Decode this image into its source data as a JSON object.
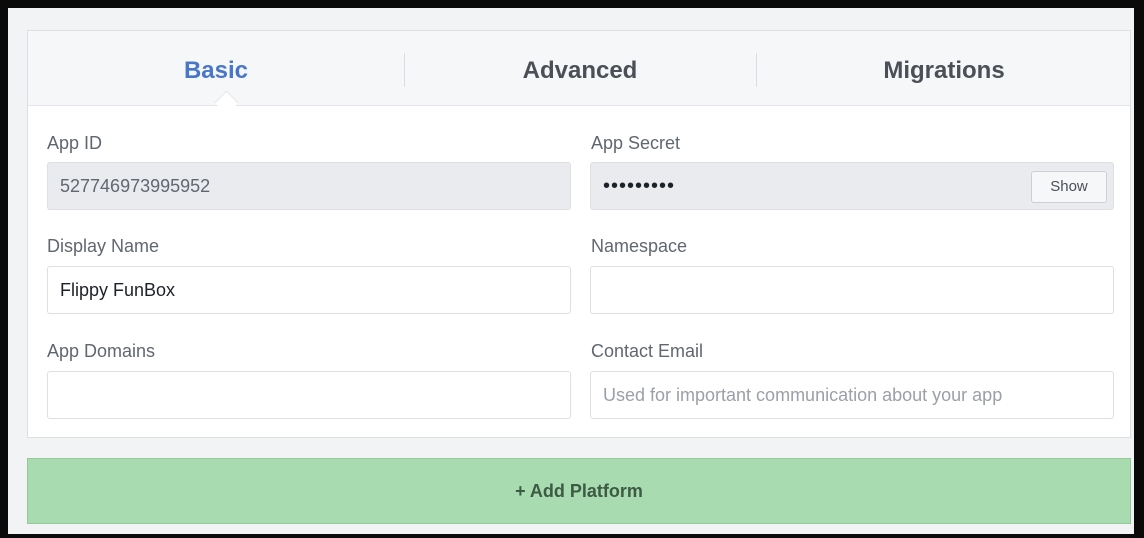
{
  "tabs": [
    {
      "label": "Basic",
      "active": true
    },
    {
      "label": "Advanced",
      "active": false
    },
    {
      "label": "Migrations",
      "active": false
    }
  ],
  "fields": {
    "app_id": {
      "label": "App ID",
      "value": "527746973995952"
    },
    "app_secret": {
      "label": "App Secret",
      "value": "•••••••••",
      "show_label": "Show"
    },
    "display_name": {
      "label": "Display Name",
      "value": "Flippy FunBox"
    },
    "namespace": {
      "label": "Namespace",
      "value": ""
    },
    "app_domains": {
      "label": "App Domains",
      "value": ""
    },
    "contact_email": {
      "label": "Contact Email",
      "placeholder": "Used for important communication about your app",
      "value": ""
    }
  },
  "add_platform": {
    "label": "+ Add Platform"
  },
  "colors": {
    "active_tab": "#4a76c8",
    "add_platform_bg": "#a8dbb0",
    "readonly_bg": "#e9ebee"
  }
}
